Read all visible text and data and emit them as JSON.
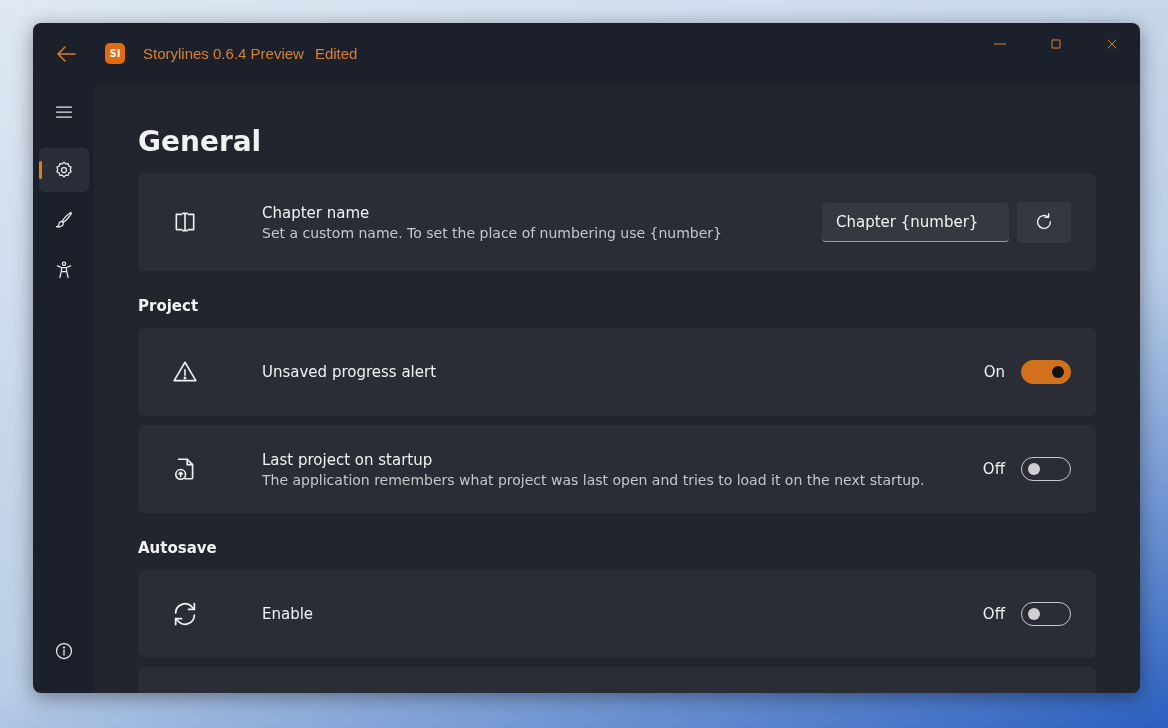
{
  "window": {
    "title": "Storylines 0.6.4 Preview",
    "status": "Edited",
    "logo": "SI"
  },
  "sidebar": {
    "items": [
      {
        "selected": true
      },
      {
        "selected": false
      },
      {
        "selected": false
      }
    ]
  },
  "page": {
    "title": "General"
  },
  "chapter_name": {
    "title": "Chapter name",
    "description": "Set a custom name. To set the place of numbering use {number}",
    "value": "Chapter {number}"
  },
  "sections": [
    {
      "heading": "Project",
      "settings": [
        {
          "title": "Unsaved progress alert",
          "on": true,
          "state_label": "On"
        },
        {
          "title": "Last project on startup",
          "description": "The application remembers what project was last open and tries to load it on the next startup.",
          "on": false,
          "state_label": "Off"
        }
      ]
    },
    {
      "heading": "Autosave",
      "settings": [
        {
          "title": "Enable",
          "on": false,
          "state_label": "Off"
        }
      ]
    }
  ]
}
